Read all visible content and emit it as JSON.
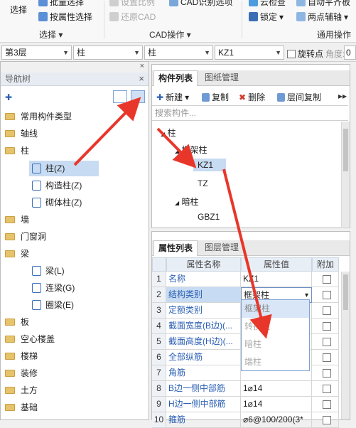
{
  "ribbon": {
    "select_big": "选择",
    "batch_select": "批量选择",
    "attr_select": "按属性选择",
    "group_select": "选择",
    "set_ratio": "设置比例",
    "restore_cad": "还原CAD",
    "cad_option": "CAD识别选项",
    "group_cad": "CAD操作",
    "cloud_check": "云检查",
    "lock": "锁定",
    "auto_level": "自动平齐板",
    "two_point_axis": "两点辅轴",
    "group_common": "通用操作"
  },
  "selectors": {
    "floor": "第3层",
    "type": "柱",
    "subtype": "柱",
    "component": "KZ1",
    "rotate_label": "旋转点",
    "angle_label": "角度:",
    "angle_value": "0"
  },
  "nav": {
    "title": "导航树",
    "items": [
      {
        "label": "常用构件类型"
      },
      {
        "label": "轴线"
      },
      {
        "label": "柱"
      },
      {
        "label": "柱(Z)"
      },
      {
        "label": "构造柱(Z)"
      },
      {
        "label": "砌体柱(Z)"
      },
      {
        "label": "墙"
      },
      {
        "label": "门窗洞"
      },
      {
        "label": "梁"
      },
      {
        "label": "梁(L)"
      },
      {
        "label": "连梁(G)"
      },
      {
        "label": "圈梁(E)"
      },
      {
        "label": "板"
      },
      {
        "label": "空心楼盖"
      },
      {
        "label": "楼梯"
      },
      {
        "label": "装修"
      },
      {
        "label": "土方"
      },
      {
        "label": "基础"
      }
    ]
  },
  "components": {
    "tab_list": "构件列表",
    "tab_drawing": "图纸管理",
    "new_label": "新建",
    "copy_label": "复制",
    "delete_label": "删除",
    "floor_copy_label": "层间复制",
    "search_placeholder": "搜索构件...",
    "tree": {
      "root": "柱",
      "frame": "框架柱",
      "kz1": "KZ1",
      "tz": "TZ",
      "hidden": "暗柱",
      "gbz1": "GBZ1"
    }
  },
  "properties": {
    "tab_list": "属性列表",
    "tab_layer": "图层管理",
    "headers": {
      "name": "属性名称",
      "value": "属性值",
      "extra": "附加"
    },
    "rows": [
      {
        "n": "1",
        "name": "名称",
        "value": "KZ1"
      },
      {
        "n": "2",
        "name": "结构类别",
        "value": "框架柱"
      },
      {
        "n": "3",
        "name": "定额类别",
        "value": ""
      },
      {
        "n": "4",
        "name": "截面宽度(B边)(...",
        "value": ""
      },
      {
        "n": "5",
        "name": "截面高度(H边)(...",
        "value": ""
      },
      {
        "n": "6",
        "name": "全部纵筋",
        "value": ""
      },
      {
        "n": "7",
        "name": "角筋",
        "value": ""
      },
      {
        "n": "8",
        "name": "B边一侧中部筋",
        "value": "1⌀14"
      },
      {
        "n": "9",
        "name": "H边一侧中部筋",
        "value": "1⌀14"
      },
      {
        "n": "10",
        "name": "箍筋",
        "value": "⌀6@100/200(3*"
      }
    ],
    "dropdown": [
      "框架柱",
      "转换柱",
      "暗柱",
      "端柱"
    ]
  },
  "colors": {
    "accent": "#2b5fb3",
    "arrow": "#e8372a",
    "folder": "#e7c36b"
  }
}
